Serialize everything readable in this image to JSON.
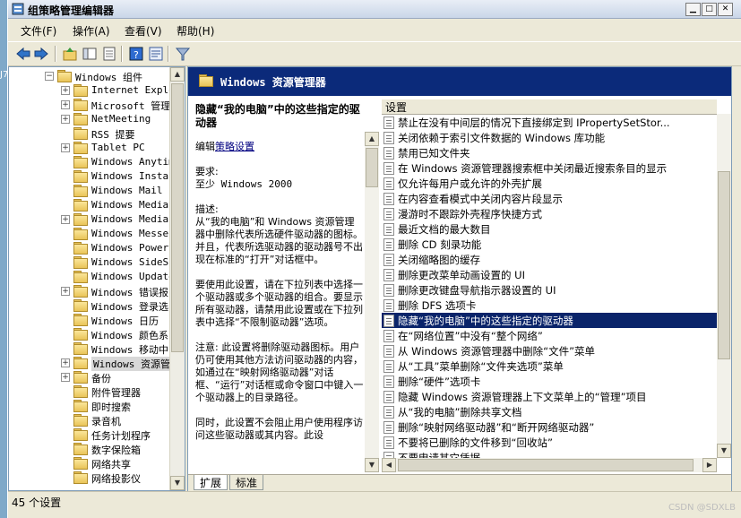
{
  "window": {
    "title": "组策略管理编辑器"
  },
  "desktop": {
    "edge_text": "J7"
  },
  "menu": {
    "items": [
      "文件(F)",
      "操作(A)",
      "查看(V)",
      "帮助(H)"
    ]
  },
  "toolbar": {
    "icons": [
      "back-icon",
      "forward-icon",
      "up-folder-icon",
      "show-hide-tree-icon",
      "export-list-icon",
      "help-icon",
      "properties-icon",
      "filter-icon"
    ]
  },
  "tree": {
    "items": [
      {
        "label": "Windows 组件",
        "expander": "−",
        "open": true
      },
      {
        "label": "Internet Explo",
        "expander": "+"
      },
      {
        "label": "Microsoft 管理",
        "expander": "+"
      },
      {
        "label": "NetMeeting",
        "expander": "+"
      },
      {
        "label": "RSS 提要",
        "expander": ""
      },
      {
        "label": "Tablet PC",
        "expander": "+"
      },
      {
        "label": "Windows Anytim",
        "expander": ""
      },
      {
        "label": "Windows Instal",
        "expander": ""
      },
      {
        "label": "Windows Mail",
        "expander": ""
      },
      {
        "label": "Windows Media",
        "expander": ""
      },
      {
        "label": "Windows Media",
        "expander": "+"
      },
      {
        "label": "Windows Messen",
        "expander": ""
      },
      {
        "label": "Windows PowerS",
        "expander": ""
      },
      {
        "label": "Windows SideSh",
        "expander": ""
      },
      {
        "label": "Windows Update",
        "expander": ""
      },
      {
        "label": "Windows 错误报",
        "expander": "+"
      },
      {
        "label": "Windows 登录选",
        "expander": ""
      },
      {
        "label": "Windows 日历",
        "expander": ""
      },
      {
        "label": "Windows 颜色系",
        "expander": ""
      },
      {
        "label": "Windows 移动中",
        "expander": ""
      },
      {
        "label": "Windows 资源管",
        "expander": "+",
        "selected": true
      },
      {
        "label": "备份",
        "expander": "+"
      },
      {
        "label": "附件管理器",
        "expander": ""
      },
      {
        "label": "即时搜索",
        "expander": ""
      },
      {
        "label": "录音机",
        "expander": ""
      },
      {
        "label": "任务计划程序",
        "expander": ""
      },
      {
        "label": "数字保险箱",
        "expander": ""
      },
      {
        "label": "网络共享",
        "expander": ""
      },
      {
        "label": "网络投影仪",
        "expander": ""
      }
    ]
  },
  "right": {
    "header": "Windows 资源管理器",
    "description": {
      "title": "隐藏“我的电脑”中的这些指定的驱动器",
      "edit_prefix": "编辑",
      "edit_link": "策略设置",
      "req_label": "要求:",
      "req_value": "至少 Windows 2000",
      "desc_label": "描述:",
      "desc_text": "从“我的电脑”和 Windows 资源管理器中删除代表所选硬件驱动器的图标。并且，代表所选驱动器的驱动器号不出现在标准的“打开”对话框中。",
      "usage": "要使用此设置，请在下拉列表中选择一个驱动器或多个驱动器的组合。要显示所有驱动器，请禁用此设置或在下拉列表中选择“不限制驱动器”选项。",
      "note": "注意: 此设置将删除驱动器图标。用户仍可使用其他方法访问驱动器的内容，如通过在“映射网络驱动器”对话框、“运行”对话框或命令窗口中键入一个驱动器上的目录路径。",
      "more": "同时，此设置不会阻止用户使用程序访问这些驱动器或其内容。此设"
    },
    "list_header": "设置",
    "settings": [
      "禁止在没有中间层的情况下直接绑定到 IPropertySetStor...",
      "关闭依赖于索引文件数据的 Windows 库功能",
      "禁用已知文件夹",
      "在 Windows 资源管理器搜索框中关闭最近搜索条目的显示",
      "仅允许每用户或允许的外壳扩展",
      "在内容查看模式中关闭内容片段显示",
      "漫游时不跟踪外壳程序快捷方式",
      "最近文档的最大数目",
      "删除 CD 刻录功能",
      "关闭缩略图的缓存",
      "删除更改菜单动画设置的 UI",
      "删除更改键盘导航指示器设置的 UI",
      "删除 DFS 选项卡",
      "隐藏“我的电脑”中的这些指定的驱动器",
      "在“网络位置”中没有“整个网络”",
      "从 Windows 资源管理器中删除“文件”菜单",
      "从“工具”菜单删除“文件夹选项”菜单",
      "删除“硬件”选项卡",
      "隐藏 Windows 资源管理器上下文菜单上的“管理”项目",
      "从“我的电脑”删除共享文档",
      "删除“映射网络驱动器”和“断开网络驱动器”",
      "不要将已删除的文件移到“回收站”",
      "不要申请其它凭据"
    ],
    "selected_index": 13,
    "tabs": [
      "扩展",
      "标准"
    ]
  },
  "status": {
    "text": "45 个设置"
  },
  "watermark": "CSDN @SDXLB"
}
